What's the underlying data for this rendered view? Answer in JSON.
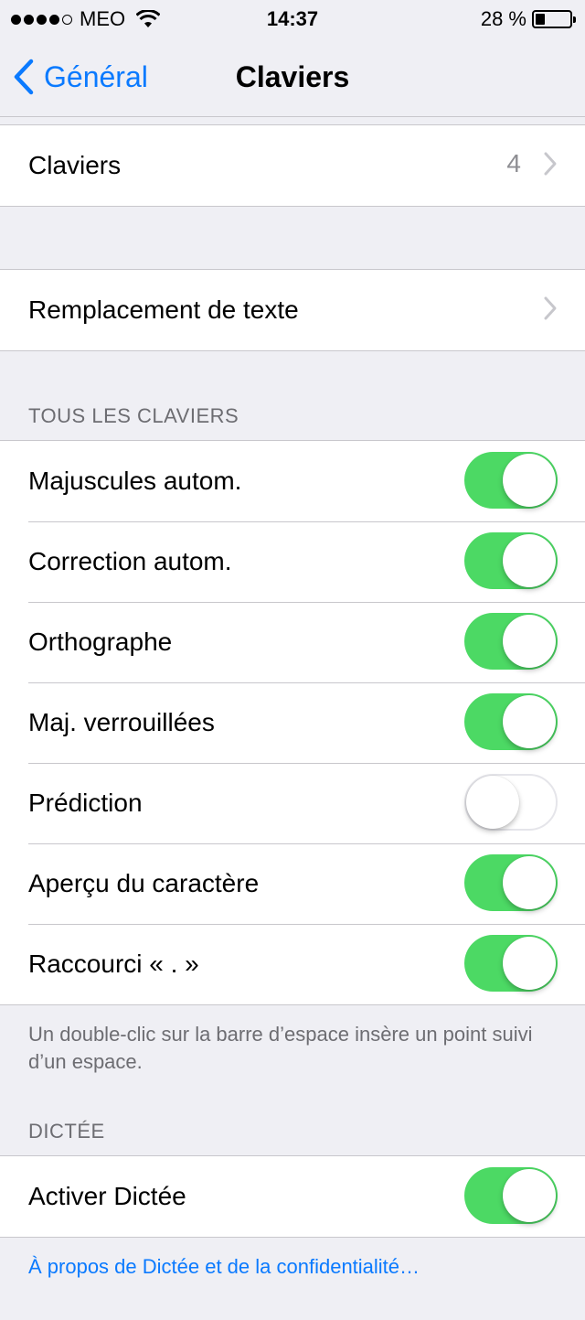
{
  "status_bar": {
    "signal_dots": [
      true,
      true,
      true,
      true,
      false
    ],
    "carrier": "MEO",
    "time": "14:37",
    "battery_text": "28 %",
    "battery_level": 0.28
  },
  "nav": {
    "back_label": "Général",
    "title": "Claviers"
  },
  "keyboards_row": {
    "label": "Claviers",
    "value": "4"
  },
  "replacement_row": {
    "label": "Remplacement de texte"
  },
  "all_keyboards": {
    "header": "TOUS LES CLAVIERS",
    "rows": [
      {
        "label": "Majuscules autom.",
        "on": true
      },
      {
        "label": "Correction autom.",
        "on": true
      },
      {
        "label": "Orthographe",
        "on": true
      },
      {
        "label": "Maj. verrouillées",
        "on": true
      },
      {
        "label": "Prédiction",
        "on": false
      },
      {
        "label": "Aperçu du caractère",
        "on": true
      },
      {
        "label": "Raccourci « . »",
        "on": true
      }
    ],
    "footer": "Un double-clic sur la barre d’espace insère un point suivi d’un espace."
  },
  "dictation": {
    "header": "DICTÉE",
    "row": {
      "label": "Activer Dictée",
      "on": true
    },
    "link": "À propos de Dictée et de la confidentialité…"
  },
  "colors": {
    "accent": "#0a7aff",
    "toggle_on": "#4cd964"
  }
}
